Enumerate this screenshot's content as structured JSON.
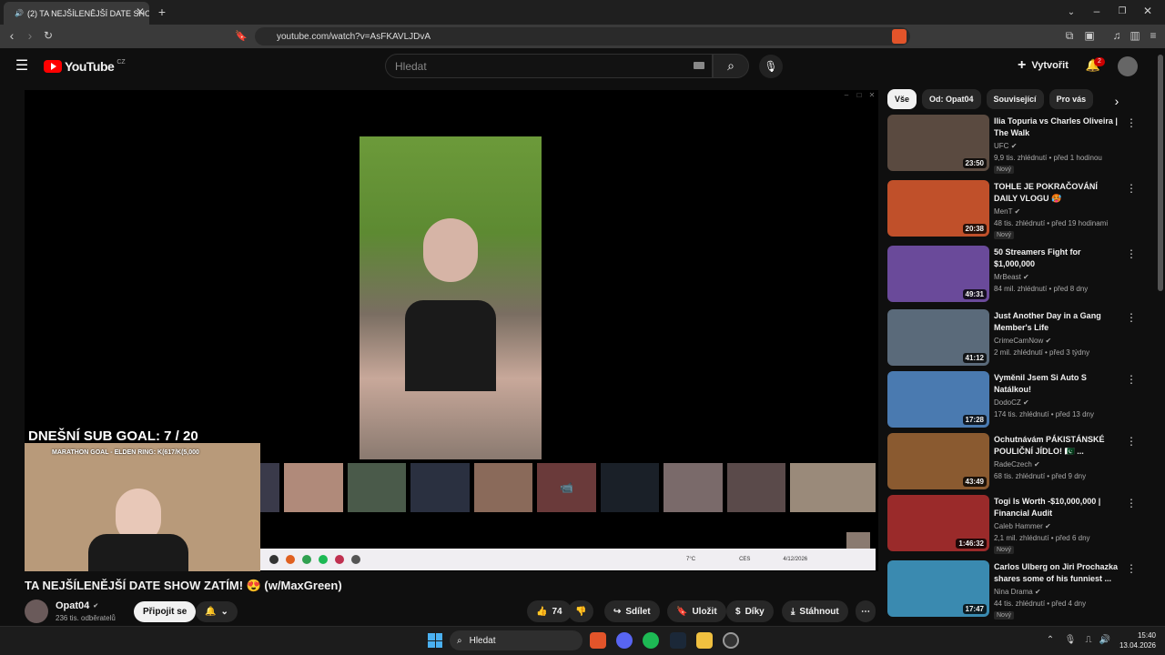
{
  "browser": {
    "tab_title": "(2) TA NEJŠÍLENĚJŠÍ DATE SHO",
    "url": "youtube.com/watch?v=AsFKAVLJDvA"
  },
  "yt": {
    "logo": "YouTube",
    "region": "CZ",
    "search_placeholder": "Hledat",
    "create": "Vytvořit",
    "notif_count": "2"
  },
  "chips": [
    "Vše",
    "Od: Opat04",
    "Související",
    "Pro vás"
  ],
  "overlay": {
    "goal": "DNEŠNÍ SUB GOAL: 7 / 20",
    "marathon": "MARATHON GOAL - ELDEN RING: K(617/K(5,000"
  },
  "stream_tray": {
    "weather": "7°C",
    "lang": "CES",
    "date": "4/12/2026"
  },
  "video": {
    "title": "TA NEJŠÍLENĚJŠÍ DATE SHOW ZATÍM! 😍 (w/MaxGreen)",
    "channel": "Opat04",
    "subs": "236 tis. odběratelů",
    "join": "Připojit se",
    "likes": "74",
    "share": "Sdílet",
    "save": "Uložit",
    "thanks": "Díky",
    "download": "Stáhnout"
  },
  "related": [
    {
      "title": "Ilia Topuria vs Charles Oliveira | The Walk",
      "channel": "UFC",
      "meta": "9,9 tis. zhlédnutí • před 1 hodinou",
      "dur": "23:50",
      "new": "Nový",
      "color": "#5a4a40"
    },
    {
      "title": "TOHLE JE POKRAČOVÁNÍ DAILY VLOGU 🥵",
      "channel": "MenT",
      "meta": "48 tis. zhlédnutí • před 19 hodinami",
      "dur": "20:38",
      "new": "Nový",
      "color": "#c0502a"
    },
    {
      "title": "50 Streamers Fight for $1,000,000",
      "channel": "MrBeast",
      "meta": "84 mil. zhlédnutí • před 8 dny",
      "dur": "49:31",
      "new": "",
      "color": "#6a4a9a"
    },
    {
      "title": "Just Another Day in a Gang Member's Life",
      "channel": "CrimeCamNow",
      "meta": "2 mil. zhlédnutí • před 3 týdny",
      "dur": "41:12",
      "new": "",
      "color": "#5a6a7a"
    },
    {
      "title": "Vyměnil Jsem Si Auto S Natálkou!",
      "channel": "DodoCZ",
      "meta": "174 tis. zhlédnutí • před 13 dny",
      "dur": "17:28",
      "new": "",
      "color": "#4a7ab0"
    },
    {
      "title": "Ochutnávám PÁKISTÁNSKÉ POULIČNÍ JÍDLO! 🇵🇰 ...",
      "channel": "RadeCzech",
      "meta": "68 tis. zhlédnutí • před 9 dny",
      "dur": "43:49",
      "new": "",
      "color": "#8a5a30"
    },
    {
      "title": "Togi Is Worth -$10,000,000 | Financial Audit",
      "channel": "Caleb Hammer",
      "meta": "2,1 mil. zhlédnutí • před 6 dny",
      "dur": "1:46:32",
      "new": "Nový",
      "color": "#9a2a2a"
    },
    {
      "title": "Carlos Ulberg on Jiri Prochazka shares some of his funniest ...",
      "channel": "Nina Drama",
      "meta": "44 tis. zhlédnutí • před 4 dny",
      "dur": "17:47",
      "new": "Nový",
      "color": "#3a8ab0"
    }
  ],
  "taskbar": {
    "search": "Hledat",
    "time": "15:40",
    "date": "13.04.2026"
  }
}
